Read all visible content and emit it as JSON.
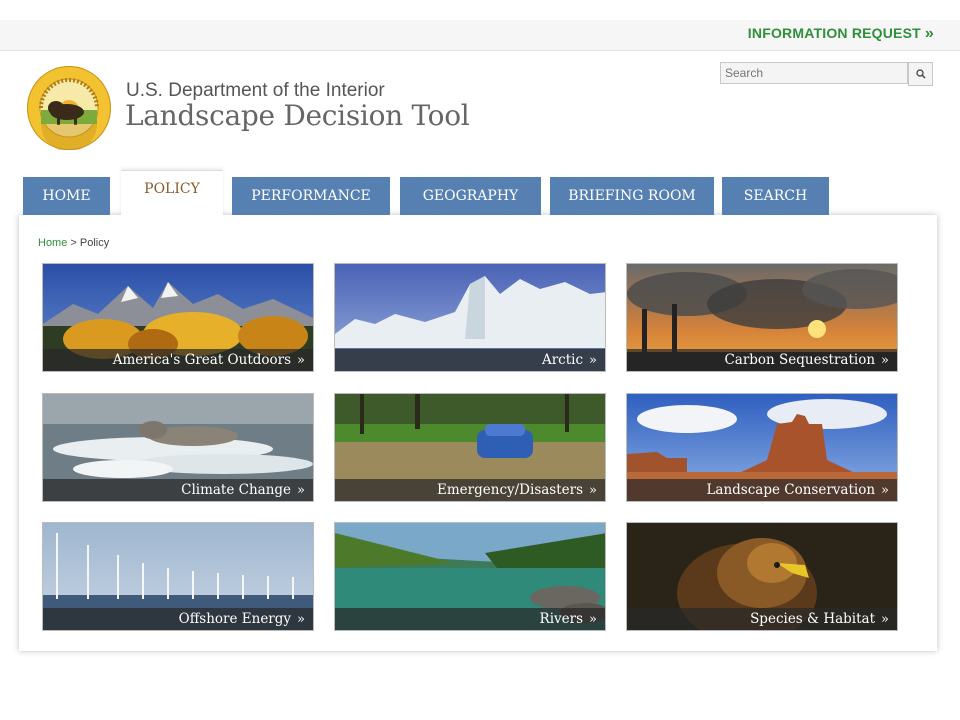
{
  "header": {
    "info_request": "INFORMATION REQUEST",
    "info_chevron": "»",
    "title_line1": "U.S. Department of the Interior",
    "title_line2": "Landscape Decision Tool",
    "search_placeholder": "Search",
    "search_icon": "magnifier-icon",
    "seal_icon": "doi-seal-bison-logo"
  },
  "nav": {
    "tabs": [
      {
        "label": "HOME"
      },
      {
        "label": "POLICY"
      },
      {
        "label": "PERFORMANCE"
      },
      {
        "label": "GEOGRAPHY"
      },
      {
        "label": "BRIEFING ROOM"
      },
      {
        "label": "SEARCH"
      }
    ],
    "active": "POLICY"
  },
  "breadcrumb": {
    "home": "Home",
    "separator": " > ",
    "current": "Policy"
  },
  "tiles": [
    {
      "label": "America's Great Outdoors",
      "chevron": "»"
    },
    {
      "label": "Arctic",
      "chevron": "»"
    },
    {
      "label": "Carbon Sequestration",
      "chevron": "»"
    },
    {
      "label": "Climate Change",
      "chevron": "»"
    },
    {
      "label": "Emergency/Disasters",
      "chevron": "»"
    },
    {
      "label": "Landscape Conservation",
      "chevron": "»"
    },
    {
      "label": "Offshore Energy",
      "chevron": "»"
    },
    {
      "label": "Rivers",
      "chevron": "»"
    },
    {
      "label": "Species & Habitat",
      "chevron": "»"
    }
  ],
  "colors": {
    "accent_green": "#2f8f3a",
    "nav_blue": "#5780b2",
    "active_tab_text": "#8a5a2b"
  }
}
